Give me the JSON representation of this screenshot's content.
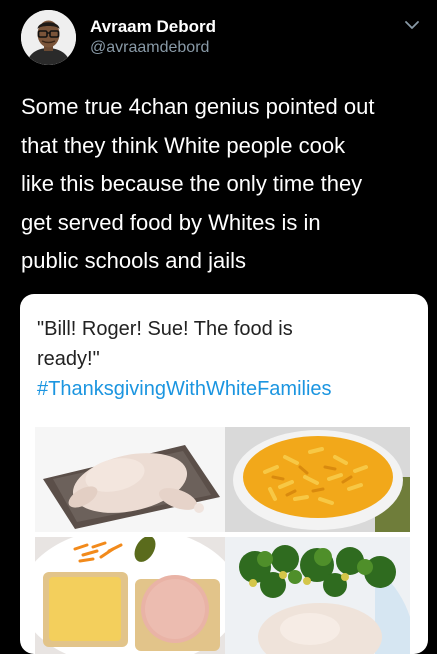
{
  "tweet": {
    "author": {
      "display_name": "Avraam Debord",
      "handle": "@avraamdebord"
    },
    "text_lines": [
      "Some true 4chan genius pointed out",
      "that they think White people cook",
      "like this because the only time they",
      "get served food by Whites is in",
      "public schools and jails"
    ],
    "icons": {
      "more": "chevron-down-icon"
    }
  },
  "quoted_image": {
    "text_lines": [
      "\"Bill! Roger! Sue! The food is",
      "ready!\""
    ],
    "hashtag": "#ThanksgivingWithWhiteFamilies"
  },
  "colors": {
    "background": "#000000",
    "handle": "#8899a6",
    "hashtag": "#1b95e0"
  }
}
